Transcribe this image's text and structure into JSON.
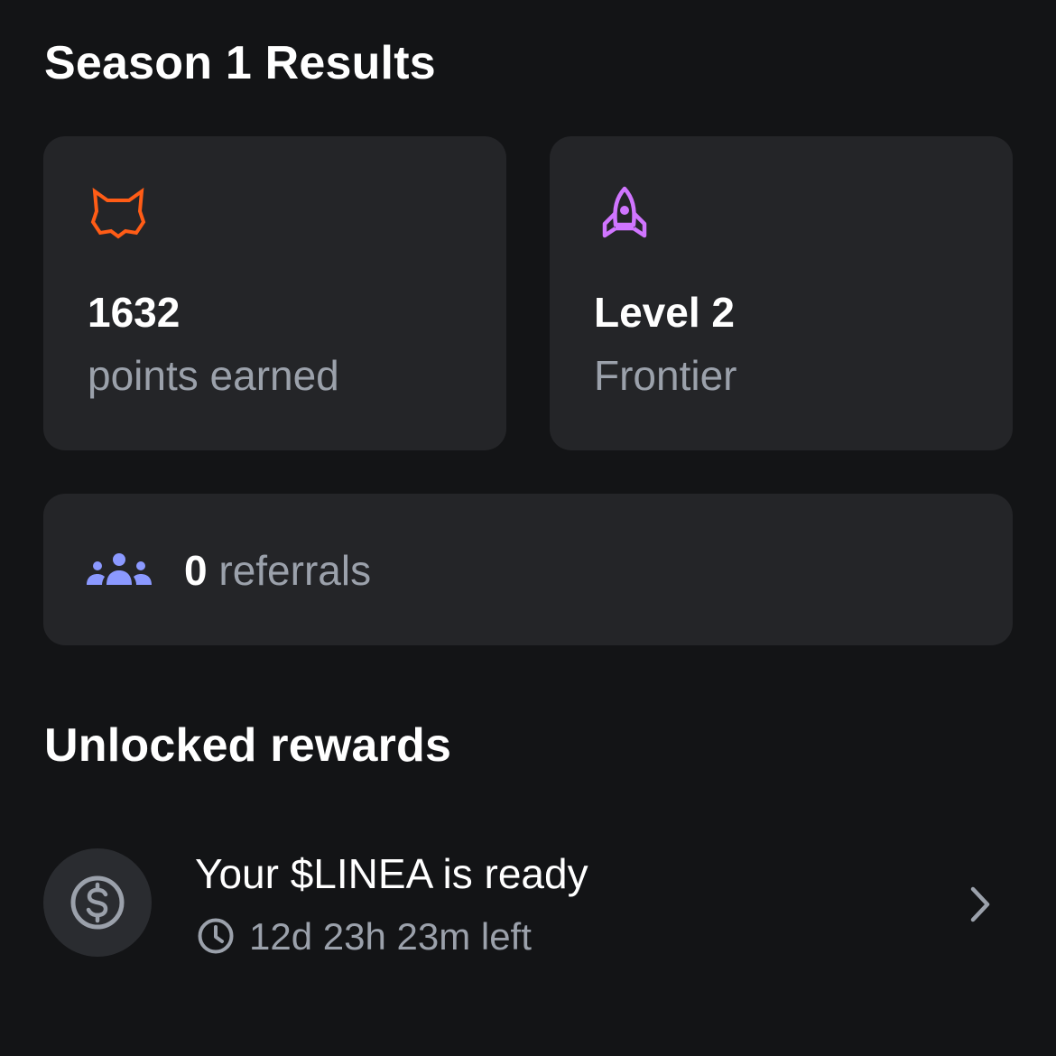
{
  "season": {
    "title": "Season 1 Results"
  },
  "stats": {
    "points": {
      "icon": "fox-icon",
      "icon_color": "#ff5c16",
      "value": "1632",
      "label": "points earned"
    },
    "level": {
      "icon": "rocket-icon",
      "icon_color": "#d075ff",
      "value": "Level 2",
      "label": "Frontier"
    },
    "referrals": {
      "icon": "people-group-icon",
      "icon_color": "#8b99ff",
      "count": "0",
      "label": "referrals"
    }
  },
  "rewards": {
    "title": "Unlocked rewards",
    "items": [
      {
        "icon": "dollar-coin-icon",
        "title": "Your $LINEA is ready",
        "time_icon": "clock-icon",
        "time_left": "12d 23h 23m left",
        "action_icon": "chevron-right-icon"
      }
    ]
  },
  "colors": {
    "background": "#131416",
    "card": "#242528",
    "text_primary": "#ffffff",
    "text_secondary": "#9ba1ab"
  }
}
